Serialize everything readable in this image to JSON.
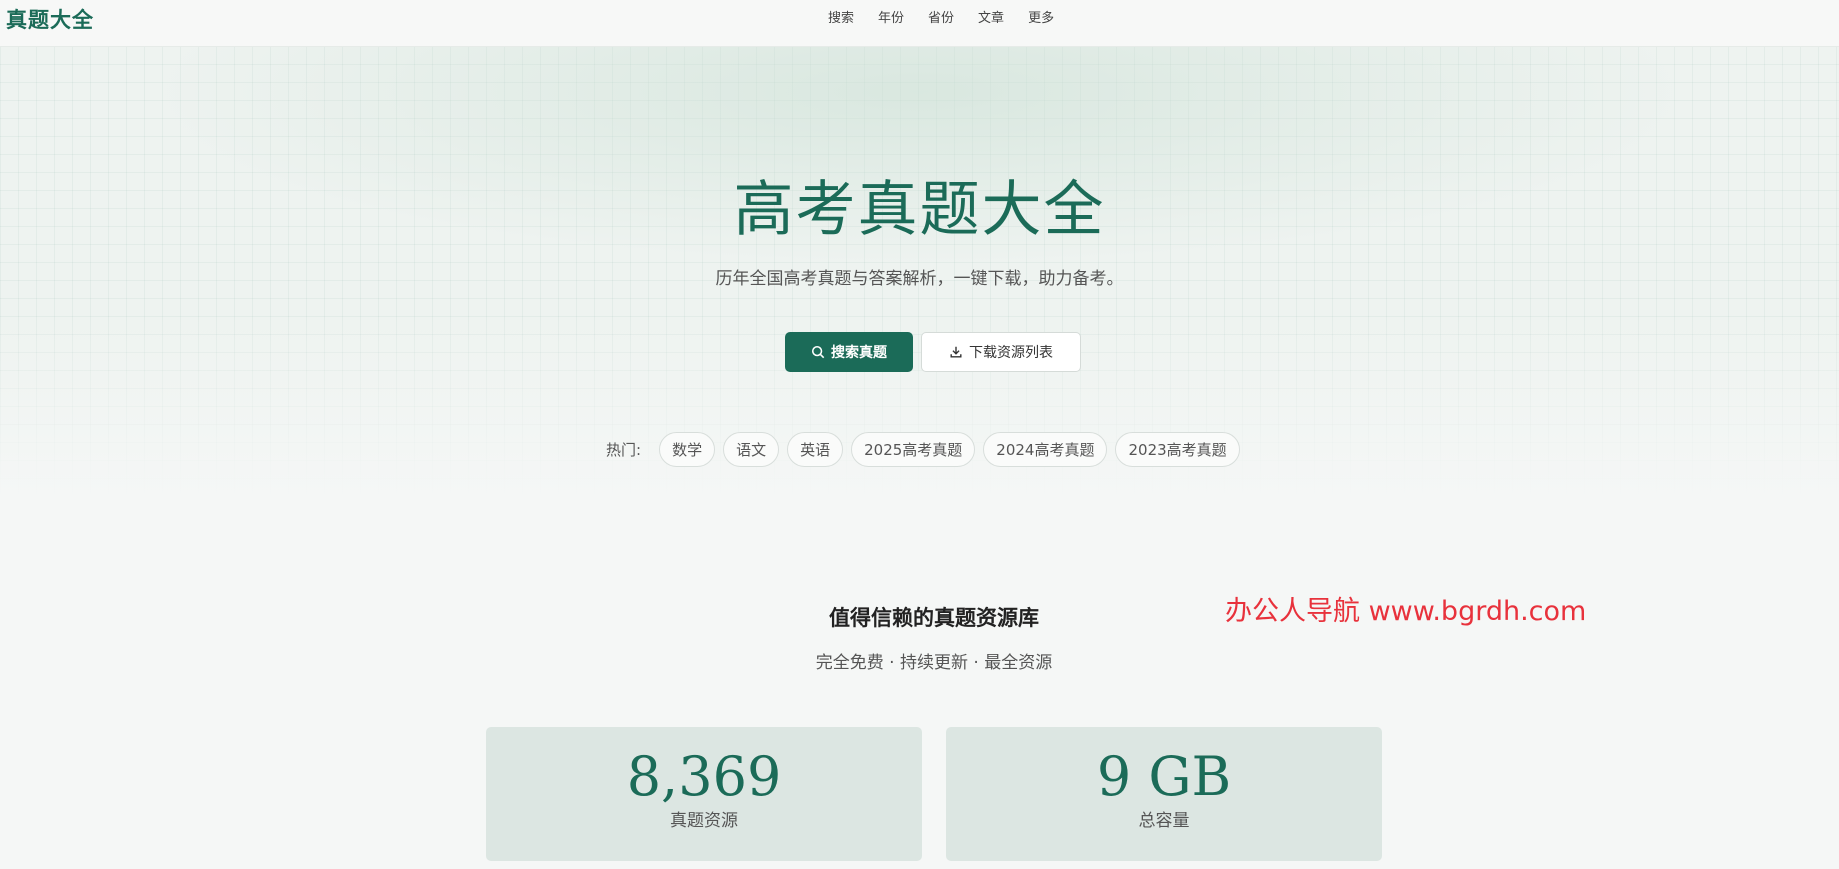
{
  "header": {
    "logo": "真题大全",
    "nav": [
      "搜索",
      "年份",
      "省份",
      "文章",
      "更多"
    ]
  },
  "hero": {
    "title": "高考真题大全",
    "subtitle": "历年全国高考真题与答案解析，一键下载，助力备考。",
    "search_button": "搜索真题",
    "download_button": "下载资源列表",
    "hot_label": "热门:",
    "hot_tags": [
      "数学",
      "语文",
      "英语",
      "2025高考真题",
      "2024高考真题",
      "2023高考真题"
    ]
  },
  "section": {
    "title": "值得信赖的真题资源库",
    "subtitle": "完全免费 · 持续更新 · 最全资源"
  },
  "watermark": "办公人导航 www.bgrdh.com",
  "stats": [
    {
      "value": "8,369",
      "label": "真题资源"
    },
    {
      "value": "9 GB",
      "label": "总容量"
    }
  ],
  "colors": {
    "brand": "#1b6b58",
    "watermark": "#e8323c"
  },
  "icons": {
    "search_button": "search-icon",
    "download_button": "download-icon"
  }
}
